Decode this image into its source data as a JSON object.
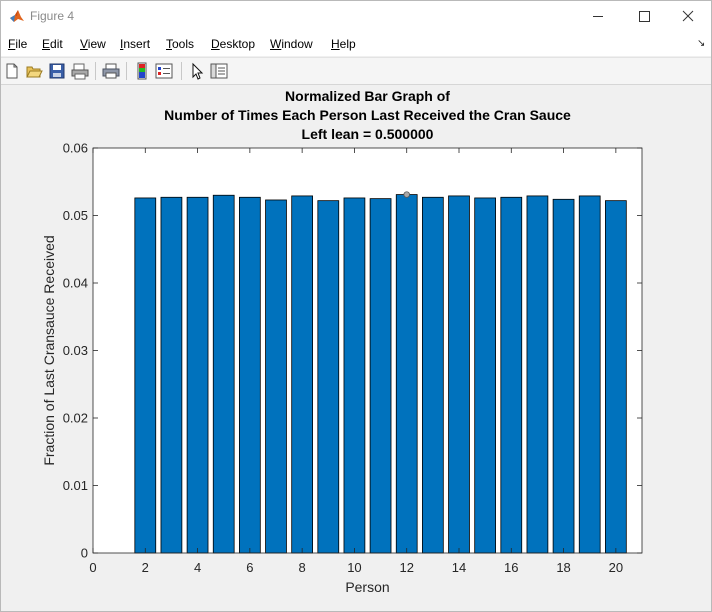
{
  "window": {
    "title": "Figure 4",
    "controls": {
      "minimize": "—",
      "maximize": "☐",
      "close": "✕"
    }
  },
  "menu": [
    {
      "label": "File",
      "accel": "F",
      "rest": "ile"
    },
    {
      "label": "Edit",
      "accel": "E",
      "rest": "dit"
    },
    {
      "label": "View",
      "accel": "V",
      "rest": "iew"
    },
    {
      "label": "Insert",
      "accel": "I",
      "rest": "nsert"
    },
    {
      "label": "Tools",
      "accel": "T",
      "rest": "ools"
    },
    {
      "label": "Desktop",
      "accel": "D",
      "rest": "esktop"
    },
    {
      "label": "Window",
      "accel": "W",
      "rest": "indow"
    },
    {
      "label": "Help",
      "accel": "H",
      "rest": "elp"
    }
  ],
  "toolbar_icons": [
    "new-figure-icon",
    "open-file-icon",
    "save-icon",
    "print-preview-icon",
    "print-icon",
    "colorbar-icon",
    "legend-icon",
    "pointer-icon",
    "property-inspector-icon"
  ],
  "colors": {
    "bar_fill": "#0072bd",
    "axes_bg": "#ffffff",
    "figure_bg": "#f0f0f0"
  },
  "chart_data": {
    "type": "bar",
    "title": [
      "Normalized Bar Graph of",
      "Number of Times Each Person Last Received the Cran Sauce",
      "Left lean = 0.500000"
    ],
    "xlabel": "Person",
    "ylabel": "Fraction of Last Cransauce Received",
    "xlim": [
      0,
      21
    ],
    "ylim": [
      0,
      0.06
    ],
    "xticks": [
      0,
      2,
      4,
      6,
      8,
      10,
      12,
      14,
      16,
      18,
      20
    ],
    "yticks": [
      0,
      0.01,
      0.02,
      0.03,
      0.04,
      0.05,
      0.06
    ],
    "ytick_labels": [
      "0",
      "0.01",
      "0.02",
      "0.03",
      "0.04",
      "0.05",
      "0.06"
    ],
    "grid": false,
    "x": [
      2,
      3,
      4,
      5,
      6,
      7,
      8,
      9,
      10,
      11,
      12,
      13,
      14,
      15,
      16,
      17,
      18,
      19,
      20
    ],
    "values": [
      0.0526,
      0.0527,
      0.0527,
      0.053,
      0.0527,
      0.0523,
      0.0529,
      0.0522,
      0.0526,
      0.0525,
      0.0531,
      0.0527,
      0.0529,
      0.0526,
      0.0527,
      0.0529,
      0.0524,
      0.0529,
      0.0522
    ],
    "marker": {
      "x": 12,
      "y": 0.0531
    }
  }
}
